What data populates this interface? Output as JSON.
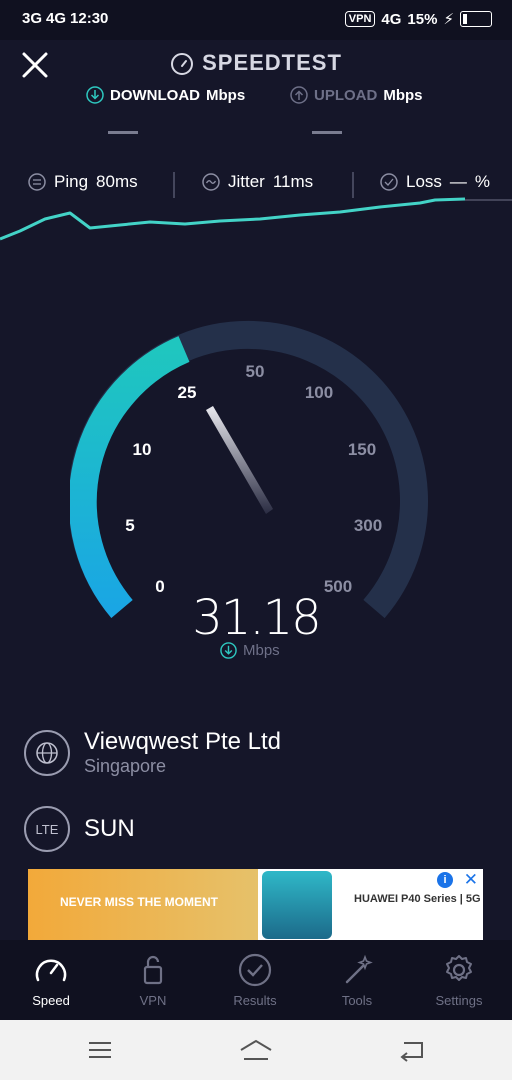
{
  "status_bar": {
    "left": [
      "3G",
      "4G",
      "12:30"
    ],
    "vpn": "VPN",
    "network": "4G",
    "battery": "15%"
  },
  "header": {
    "title": "SPEEDTEST",
    "download_label": "DOWNLOAD",
    "download_unit": "Mbps",
    "upload_label": "UPLOAD",
    "upload_unit": "Mbps"
  },
  "metrics": {
    "ping_label": "Ping",
    "ping_value": "80ms",
    "jitter_label": "Jitter",
    "jitter_value": "11ms",
    "loss_label": "Loss",
    "loss_value": "—",
    "loss_unit": "%"
  },
  "gauge": {
    "ticks": [
      "0",
      "5",
      "10",
      "25",
      "50",
      "100",
      "150",
      "300",
      "500"
    ],
    "current": "31.18",
    "unit": "Mbps",
    "colors": {
      "track": "#24304a",
      "fill_start": "#1aa6e4",
      "fill_end": "#1fc6bf"
    }
  },
  "server": {
    "name": "Viewqwest Pte Ltd",
    "location": "Singapore",
    "server_icon": "globe-icon"
  },
  "isp": {
    "badge": "LTE",
    "name": "SUN"
  },
  "ad": {
    "text_left": "NEVER MISS THE MOMENT",
    "text_right": "HUAWEI P40 Series | 5G"
  },
  "tabs": [
    {
      "label": "Speed",
      "icon": "speedometer-icon",
      "active": true
    },
    {
      "label": "VPN",
      "icon": "lock-icon",
      "active": false
    },
    {
      "label": "Results",
      "icon": "checkmark-icon",
      "active": false
    },
    {
      "label": "Tools",
      "icon": "wand-icon",
      "active": false
    },
    {
      "label": "Settings",
      "icon": "gear-icon",
      "active": false
    }
  ]
}
